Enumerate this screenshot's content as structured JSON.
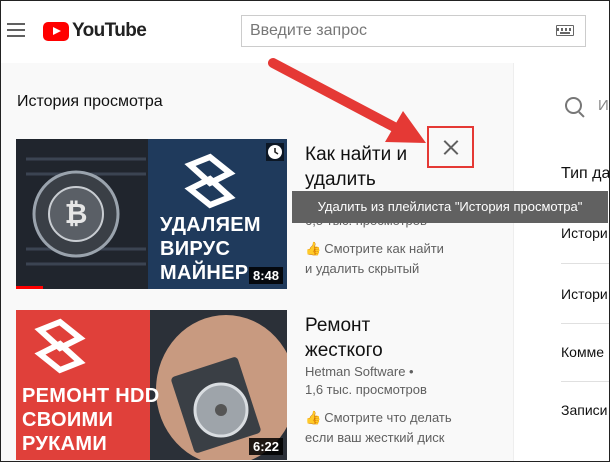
{
  "header": {
    "logo_text": "YouTube",
    "search_placeholder": "Введите запрос"
  },
  "main": {
    "section_title": "История просмотра",
    "videos": [
      {
        "title_line1": "Как найти и",
        "title_line2": "удалить",
        "views": "6,5 тыс. просмотров",
        "desc_line1": "Смотрите как найти",
        "desc_line2": "и удалить скрытый",
        "duration": "8:48",
        "thumb_lines": [
          "УДАЛЯЕМ",
          "ВИРУС",
          "МАЙНЕР"
        ],
        "progress_percent": 10
      },
      {
        "title_line1": "Ремонт",
        "title_line2": "жесткого",
        "channel": "Hetman Software •",
        "views": "1,6 тыс. просмотров",
        "desc_line1": "Смотрите что делать",
        "desc_line2": "если ваш жесткий диск",
        "duration": "6:22",
        "thumb_lines": [
          "РЕМОНТ HDD",
          "СВОИМИ",
          "РУКАМИ"
        ],
        "progress_percent": 0
      }
    ]
  },
  "tooltip": {
    "text": "Удалить из плейлиста \"История просмотра\""
  },
  "right_panel": {
    "search_text": "И",
    "heading": "Тип да",
    "items": [
      "Истори",
      "Истори",
      "Комме",
      "Записи"
    ]
  },
  "colors": {
    "brand_red": "#ff0000",
    "annotation_red": "#e53935",
    "thumb_navy": "#1f3a5c",
    "thumb_red": "#e0403a"
  },
  "icons": [
    "menu-icon",
    "youtube-logo-icon",
    "keyboard-icon",
    "clock-icon",
    "close-icon",
    "thumbs-up-icon",
    "search-icon"
  ]
}
